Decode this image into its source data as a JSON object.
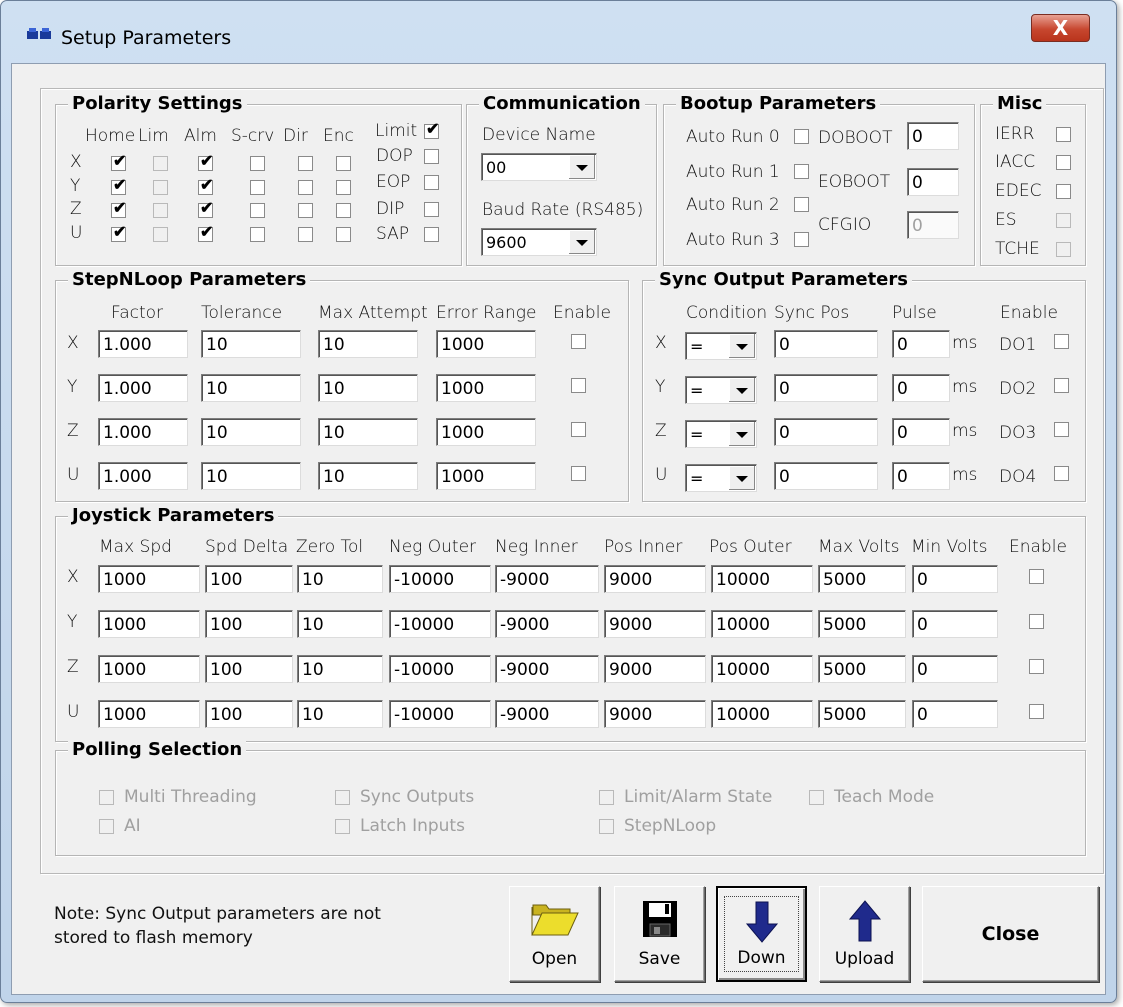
{
  "window": {
    "title": "Setup Parameters",
    "close_glyph": "X"
  },
  "polarity": {
    "title": "Polarity Settings",
    "columns": [
      "Home",
      "Lim",
      "Alm",
      "S-crv",
      "Dir",
      "Enc"
    ],
    "axes": [
      "X",
      "Y",
      "Z",
      "U"
    ],
    "checks": [
      [
        true,
        false,
        true,
        false,
        false,
        false
      ],
      [
        true,
        false,
        true,
        false,
        false,
        false
      ],
      [
        true,
        false,
        true,
        false,
        false,
        false
      ],
      [
        true,
        false,
        true,
        false,
        false,
        false
      ]
    ],
    "disabled_col": 1,
    "side": [
      {
        "label": "Limit",
        "checked": true
      },
      {
        "label": "DOP",
        "checked": false
      },
      {
        "label": "EOP",
        "checked": false
      },
      {
        "label": "DIP",
        "checked": false
      },
      {
        "label": "SAP",
        "checked": false
      }
    ]
  },
  "communication": {
    "title": "Communication",
    "device_label": "Device Name",
    "device_value": "00",
    "baud_label": "Baud Rate (RS485)",
    "baud_value": "9600"
  },
  "bootup": {
    "title": "Bootup Parameters",
    "autoruns": [
      "Auto Run 0",
      "Auto Run 1",
      "Auto Run 2",
      "Auto Run 3"
    ],
    "doboot_label": "DOBOOT",
    "doboot_value": "0",
    "eoboot_label": "EOBOOT",
    "eoboot_value": "0",
    "cfgio_label": "CFGIO",
    "cfgio_value": "0"
  },
  "misc": {
    "title": "Misc",
    "items": [
      "IERR",
      "IACC",
      "EDEC",
      "ES",
      "TCHE"
    ]
  },
  "stepnloop": {
    "title": "StepNLoop Parameters",
    "headers": [
      "Factor",
      "Tolerance",
      "Max Attempt",
      "Error Range",
      "Enable"
    ],
    "axes": [
      "X",
      "Y",
      "Z",
      "U"
    ],
    "rows": [
      [
        "1.000",
        "10",
        "10",
        "1000"
      ],
      [
        "1.000",
        "10",
        "10",
        "1000"
      ],
      [
        "1.000",
        "10",
        "10",
        "1000"
      ],
      [
        "1.000",
        "10",
        "10",
        "1000"
      ]
    ]
  },
  "sync": {
    "title": "Sync Output Parameters",
    "headers": [
      "Condition",
      "Sync Pos",
      "Pulse",
      "Enable"
    ],
    "axes": [
      "X",
      "Y",
      "Z",
      "U"
    ],
    "unit": "ms",
    "rows": [
      {
        "cond": "=",
        "pos": "0",
        "pulse": "0",
        "do": "DO1"
      },
      {
        "cond": "=",
        "pos": "0",
        "pulse": "0",
        "do": "DO2"
      },
      {
        "cond": "=",
        "pos": "0",
        "pulse": "0",
        "do": "DO3"
      },
      {
        "cond": "=",
        "pos": "0",
        "pulse": "0",
        "do": "DO4"
      }
    ]
  },
  "joystick": {
    "title": "Joystick Parameters",
    "headers": [
      "Max Spd",
      "Spd Delta",
      "Zero Tol",
      "Neg Outer",
      "Neg Inner",
      "Pos Inner",
      "Pos Outer",
      "Max Volts",
      "Min Volts",
      "Enable"
    ],
    "axes": [
      "X",
      "Y",
      "Z",
      "U"
    ],
    "rows": [
      [
        "1000",
        "100",
        "10",
        "-10000",
        "-9000",
        "9000",
        "10000",
        "5000",
        "0"
      ],
      [
        "1000",
        "100",
        "10",
        "-10000",
        "-9000",
        "9000",
        "10000",
        "5000",
        "0"
      ],
      [
        "1000",
        "100",
        "10",
        "-10000",
        "-9000",
        "9000",
        "10000",
        "5000",
        "0"
      ],
      [
        "1000",
        "100",
        "10",
        "-10000",
        "-9000",
        "9000",
        "10000",
        "5000",
        "0"
      ]
    ]
  },
  "polling": {
    "title": "Polling Selection",
    "items": [
      "Multi Threading",
      "Sync Outputs",
      "Limit/Alarm State",
      "Teach Mode",
      "AI",
      "Latch Inputs",
      "StepNLoop"
    ]
  },
  "note": {
    "line1": "Note: Sync Output parameters are not",
    "line2": "stored to flash memory"
  },
  "buttons": {
    "open": "Open",
    "save": "Save",
    "down": "Down",
    "upload": "Upload",
    "close": "Close"
  },
  "colors": {
    "folder": "#e8d62a",
    "floppy": "#000000",
    "arrow": "#1f2a8c",
    "title_close": "#c7472f"
  }
}
